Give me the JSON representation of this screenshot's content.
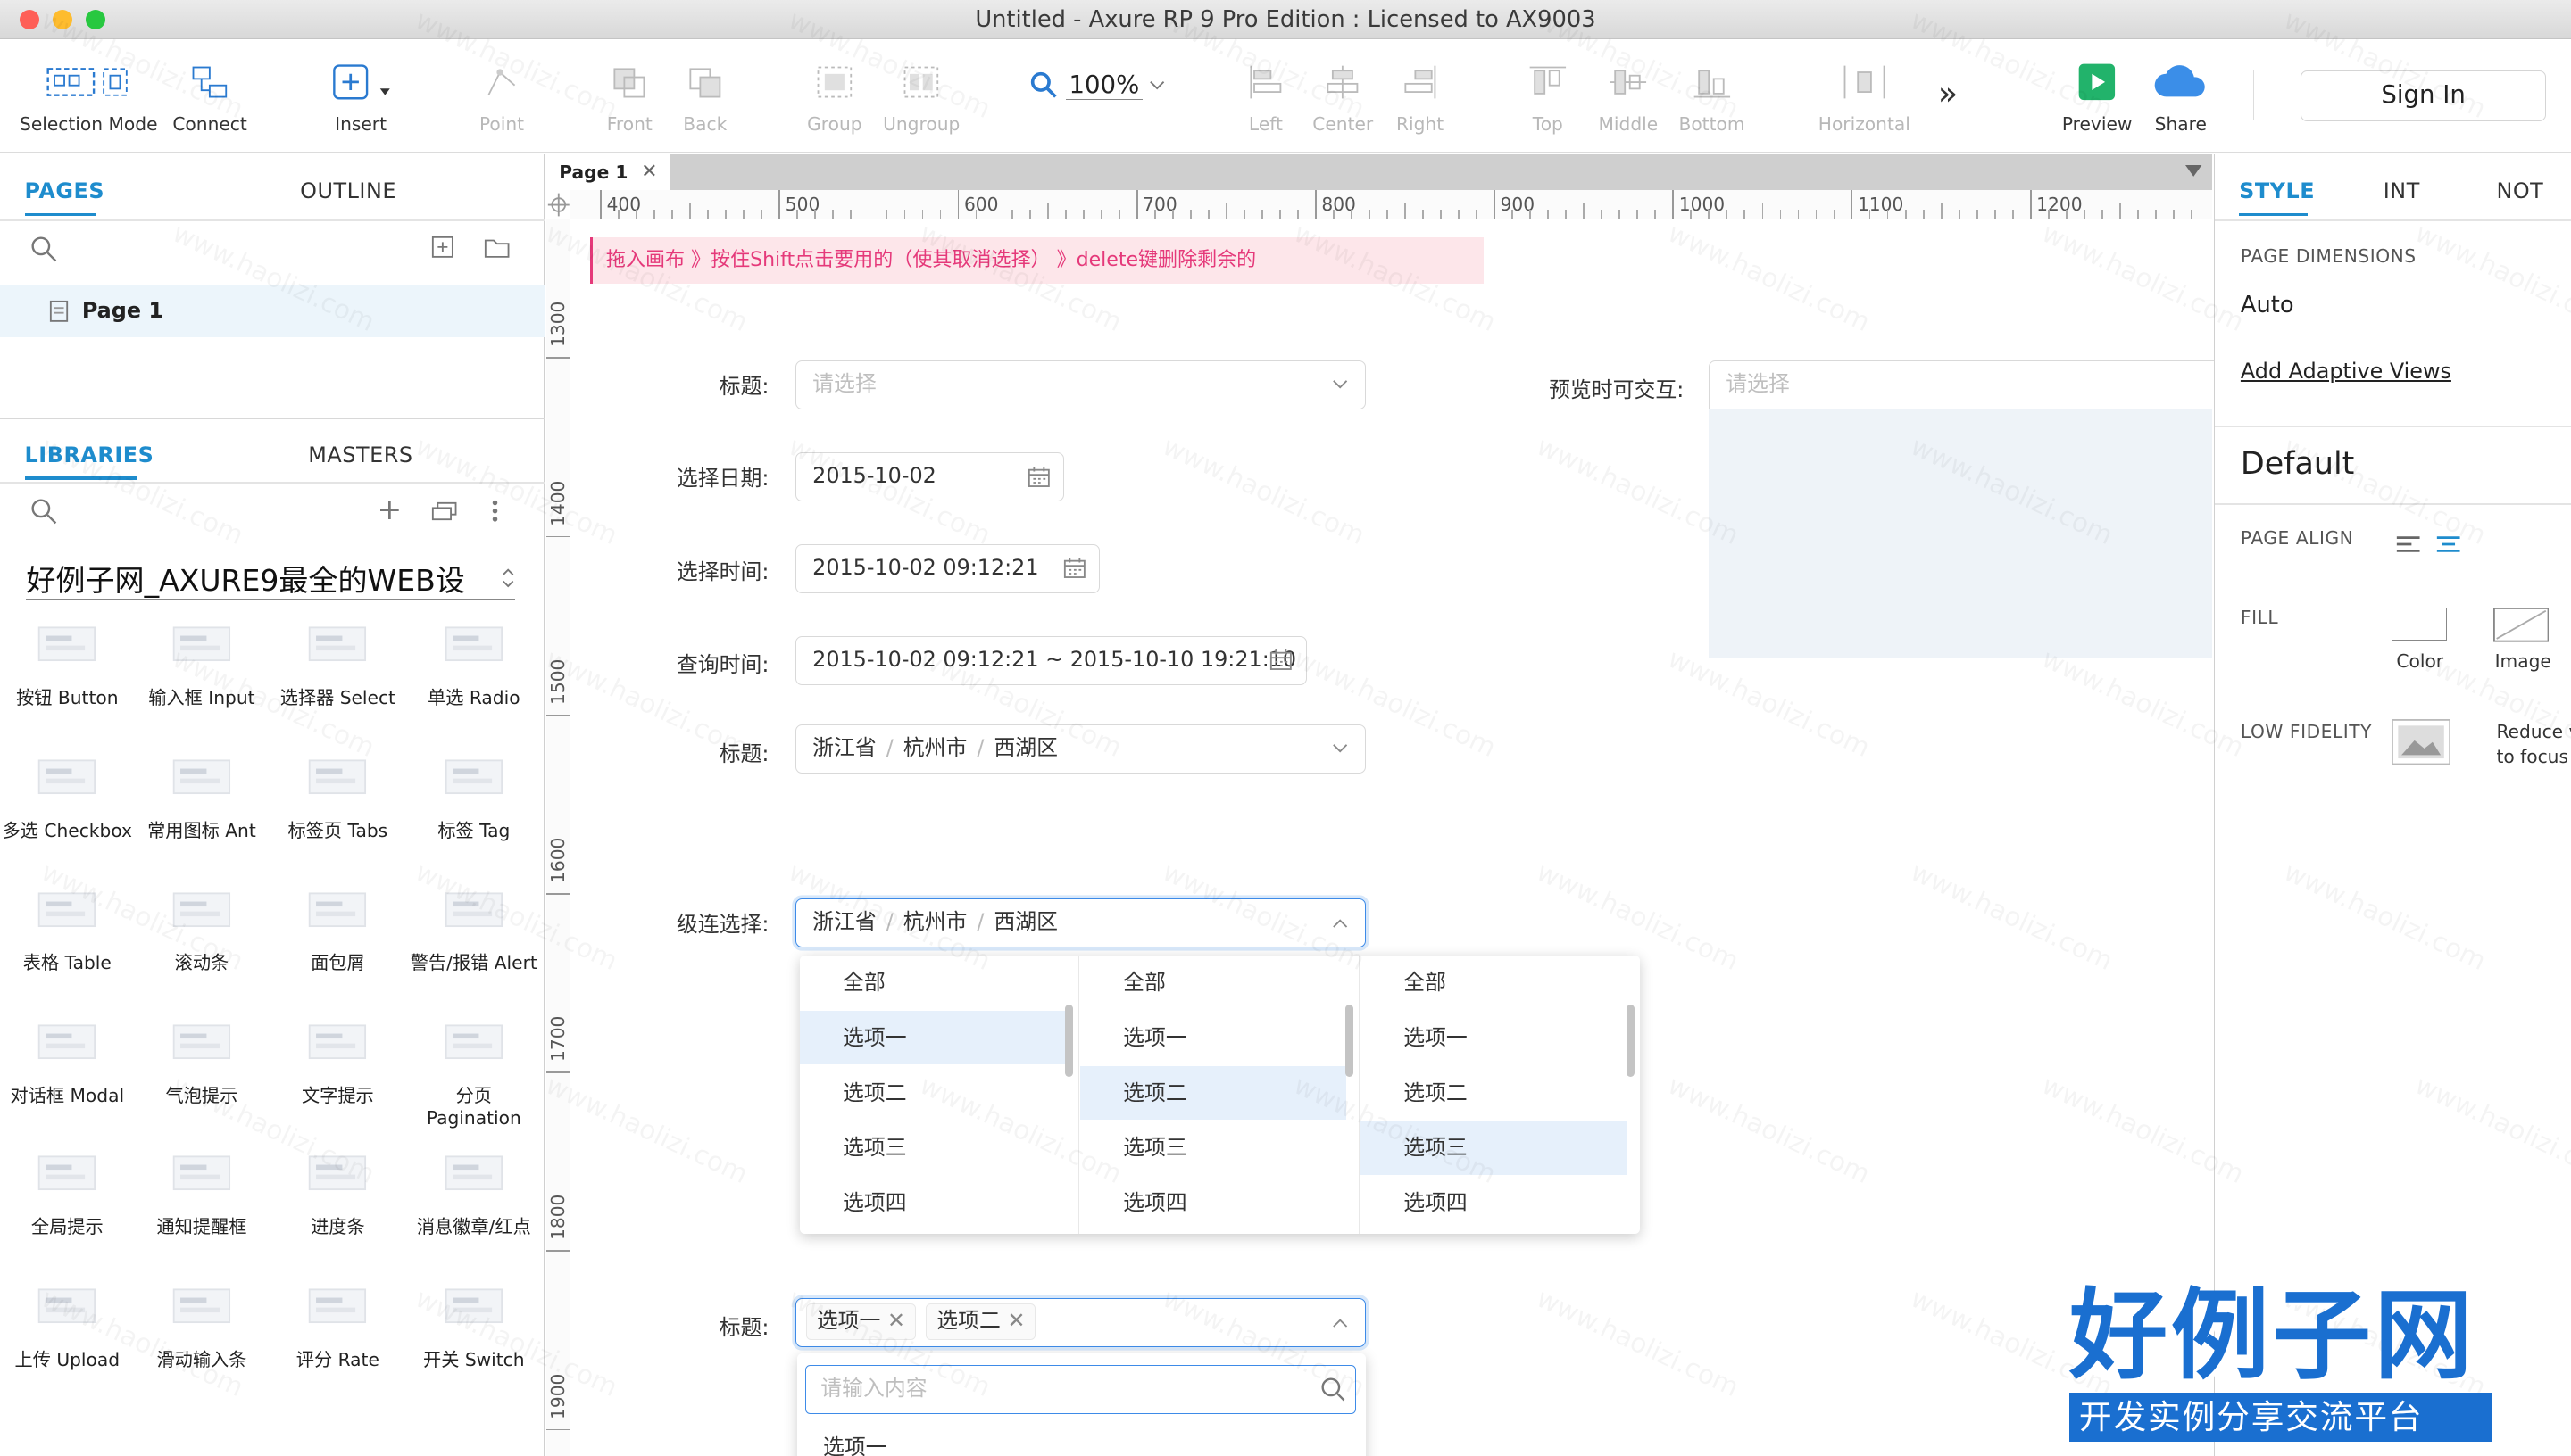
{
  "window": {
    "title": "Untitled - Axure RP 9 Pro Edition : Licensed to AX9003"
  },
  "toolbar": {
    "selection_mode": "Selection Mode",
    "connect": "Connect",
    "insert": "Insert",
    "point": "Point",
    "front": "Front",
    "back": "Back",
    "group": "Group",
    "ungroup": "Ungroup",
    "zoom": "100%",
    "left": "Left",
    "center": "Center",
    "right": "Right",
    "top": "Top",
    "middle": "Middle",
    "bottom": "Bottom",
    "horizontal": "Horizontal",
    "more": "»",
    "preview": "Preview",
    "share": "Share",
    "sign_in": "Sign In"
  },
  "pages_panel": {
    "tabs": [
      "PAGES",
      "OUTLINE"
    ],
    "pages": [
      "Page 1"
    ]
  },
  "libraries_panel": {
    "tabs": [
      "LIBRARIES",
      "MASTERS"
    ],
    "library_name": "好例子网_AXURE9最全的WEB设",
    "items": [
      "按钮 Button",
      "输入框 Input",
      "选择器 Select",
      "单选 Radio",
      "多选 Checkbox",
      "常用图标 Ant",
      "标签页 Tabs",
      "标签 Tag",
      "表格 Table",
      "滚动条",
      "面包屑",
      "警告/报错 Alert",
      "对话框 Modal",
      "气泡提示",
      "文字提示",
      "分页 Pagination",
      "全局提示",
      "通知提醒框",
      "进度条",
      "消息徽章/红点",
      "上传 Upload",
      "滑动输入条",
      "评分 Rate",
      "开关 Switch"
    ]
  },
  "canvas": {
    "page_tab": "Page 1",
    "ruler_h": [
      "400",
      "500",
      "600",
      "700",
      "800",
      "900",
      "1000",
      "1100",
      "1200"
    ],
    "ruler_v": [
      "1300",
      "1400",
      "1500",
      "1600",
      "1700",
      "1800",
      "1900"
    ],
    "hint": "拖入画布 》按住Shift点击要用的（使其取消选择） 》delete键删除剩余的",
    "form": {
      "title_label": "标题:",
      "title_placeholder": "请选择",
      "preview_label": "预览时可交互:",
      "preview_placeholder": "请选择",
      "date_label": "选择日期:",
      "date_value": "2015-10-02",
      "time_label": "选择时间:",
      "time_value": "2015-10-02 09:12:21",
      "range_label": "查询时间:",
      "range_value": "2015-10-02 09:12:21 ~ 2015-10-10 19:21:10",
      "cascader_title_label": "标题:",
      "cascader_parts": [
        "浙江省",
        "杭州市",
        "西湖区"
      ],
      "cascader_label": "级连选择:",
      "dropdown_options": [
        "全部",
        "选项一",
        "选项二",
        "选项三",
        "选项四"
      ],
      "multi_label": "标题:",
      "multi_tags": [
        "选项一",
        "选项二"
      ],
      "search_placeholder": "请输入内容",
      "multi_first_option": "选项一"
    }
  },
  "style_panel": {
    "tabs": [
      "STYLE",
      "INT",
      "NOT"
    ],
    "page_dimensions_label": "PAGE DIMENSIONS",
    "page_dimensions_value": "Auto",
    "adaptive_link": "Add Adaptive Views",
    "default_label": "Default",
    "page_align_label": "PAGE ALIGN",
    "fill_label": "FILL",
    "fill_color": "Color",
    "fill_image": "Image",
    "low_fidelity_label": "LOW FIDELITY",
    "low_fidelity_text1": "Reduce v",
    "low_fidelity_text2": "to focus c"
  },
  "branding": {
    "logo_text": "好例子网",
    "logo_sub": "开发实例分享交流平台",
    "watermark": "www.haolizi.com"
  },
  "colors": {
    "accent": "#1e8ccd",
    "focus": "#3e8be8",
    "hint_bg": "#fde6ea",
    "hint_text": "#e5397a"
  }
}
